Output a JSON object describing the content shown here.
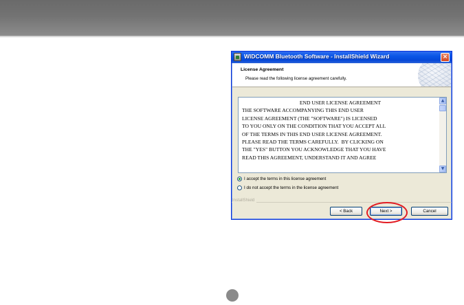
{
  "window": {
    "title": "WIDCOMM Bluetooth Software  - InstallShield Wizard",
    "close_glyph": "×"
  },
  "header": {
    "title": "License Agreement",
    "subtitle": "Please read the following license agreement carefully."
  },
  "license": {
    "heading": "END USER LICENSE AGREEMENT",
    "lines": [
      "THE SOFTWARE ACCOMPANYING THIS END USER",
      "LICENSE AGREEMENT (THE \"SOFTWARE\") IS LICENSED",
      "TO YOU ONLY ON THE CONDITION THAT YOU ACCEPT ALL",
      "OF THE TERMS IN THIS END USER LICENSE AGREEMENT.",
      "PLEASE READ THE TERMS CAREFULLY.  BY CLICKING ON",
      "THE \"YES\" BUTTON YOU ACKNOWLEDGE THAT YOU HAVE",
      "READ THIS AGREEMENT, UNDERSTAND IT AND AGREE"
    ],
    "scroll_up": "▲",
    "scroll_down": "▼"
  },
  "options": {
    "accept": "I accept the terms in this license agreement",
    "decline": "I do not accept the terms in the license agreement",
    "selected": "accept"
  },
  "footer": {
    "installshield_label": "InstallShield",
    "back": "< Back",
    "next": "Next >",
    "cancel": "Cancel"
  },
  "colors": {
    "top_band": "#737373",
    "highlight_ring": "#e21b22",
    "titlebar": "#0a55e6"
  },
  "icons": [
    "app-icon",
    "close-icon",
    "scroll-up-icon",
    "scroll-down-icon",
    "globe-icon",
    "page-dot-icon"
  ]
}
